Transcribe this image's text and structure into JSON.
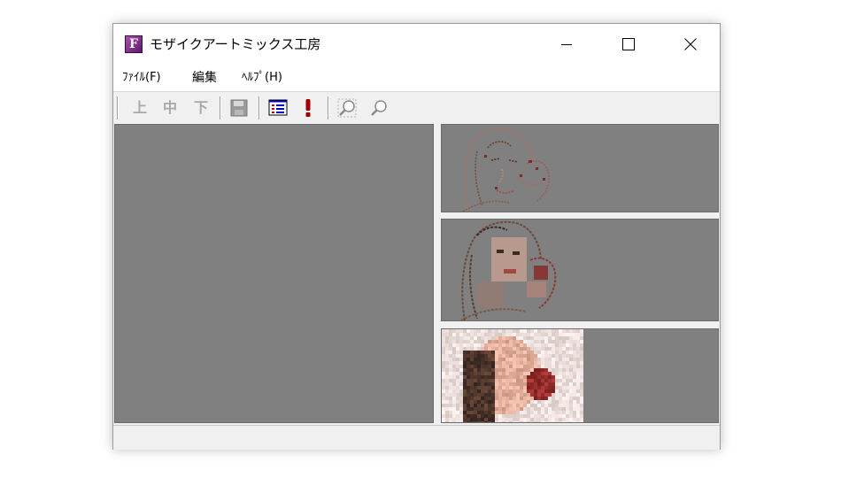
{
  "window": {
    "title": "モザイクアートミックス工房",
    "icon_letter": "F"
  },
  "window_controls": {
    "minimize": "minimize-icon",
    "maximize": "maximize-icon",
    "close": "close-icon"
  },
  "menu": {
    "file": "ﾌｧｲﾙ(F)",
    "edit": "編集",
    "help": "ﾍﾙﾌﾟ(H)"
  },
  "toolbar": {
    "top_label": "上",
    "middle_label": "中",
    "bottom_label": "下",
    "icons": [
      "save-icon",
      "list-icon",
      "exclamation-icon",
      "zoom-in-icon",
      "zoom-out-icon"
    ]
  },
  "colors": {
    "pane_background": "#808080",
    "accent_red": "#c00000",
    "accent_blue": "#0000c0"
  },
  "panels": [
    "outline-view",
    "sketch-view",
    "mosaic-view"
  ]
}
